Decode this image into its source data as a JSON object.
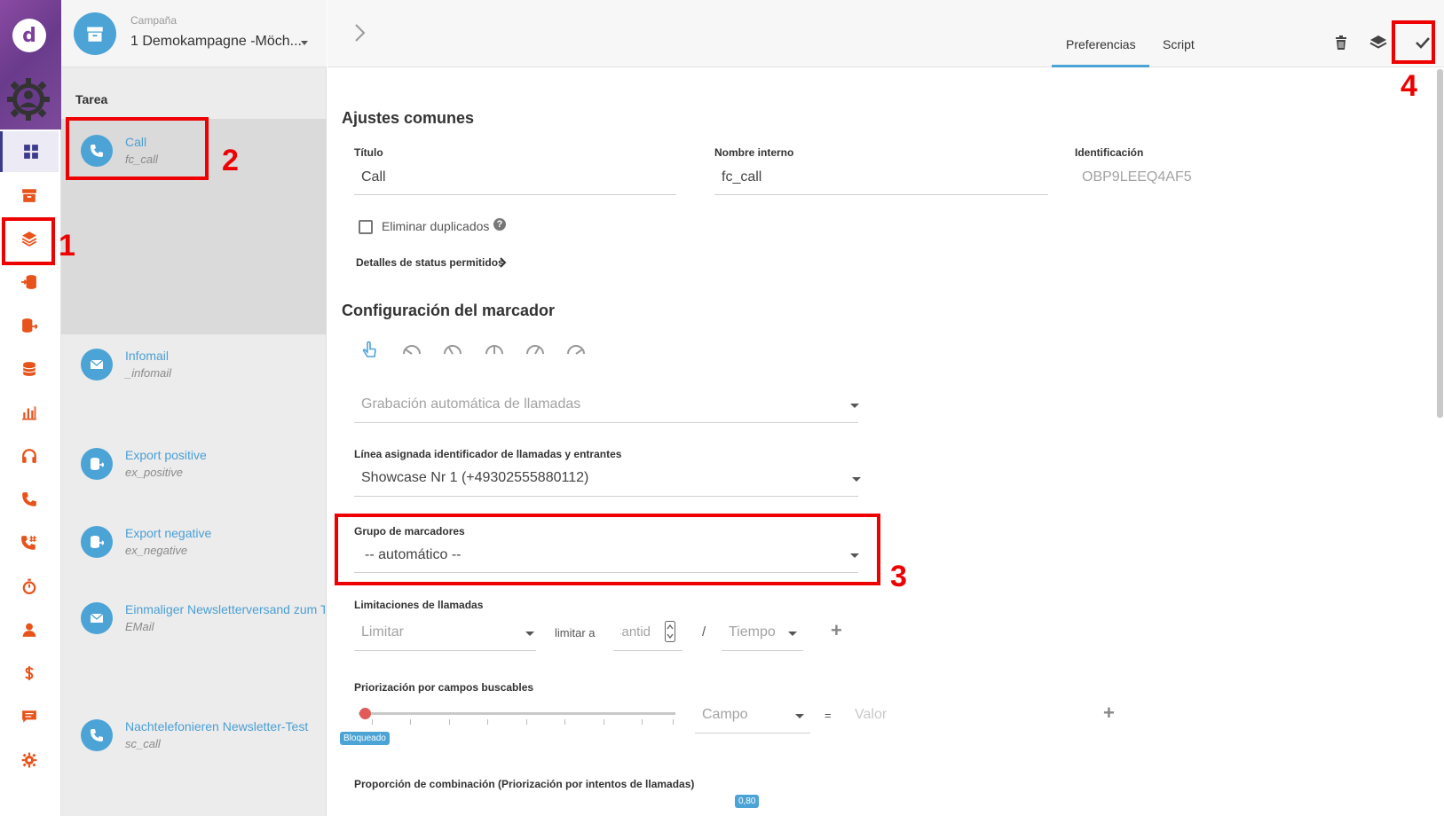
{
  "campaign": {
    "label": "Campaña",
    "value": "1 Demokampagne -Möch..."
  },
  "tasks_header": "Tarea",
  "tasks": [
    {
      "name": "Call",
      "sub": "fc_call",
      "icon": "phone-icon",
      "selected": true
    },
    {
      "name": "Infomail",
      "sub": "_infomail",
      "icon": "envelope-icon"
    },
    {
      "name": "Export positive",
      "sub": "ex_positive",
      "icon": "database-export-icon"
    },
    {
      "name": "Export negative",
      "sub": "ex_negative",
      "icon": "database-export-icon"
    },
    {
      "name": "Einmaliger Newsletterversand zum T",
      "sub": "EMail",
      "icon": "envelope-icon"
    },
    {
      "name": "Nachtelefonieren Newsletter-Test",
      "sub": "sc_call",
      "icon": "phone-icon"
    }
  ],
  "tabs": {
    "preferences": "Preferencias",
    "script": "Script"
  },
  "common": {
    "title": "Ajustes comunes",
    "titulo_label": "Título",
    "titulo_value": "Call",
    "internal_label": "Nombre interno",
    "internal_value": "fc_call",
    "id_label": "Identificación",
    "id_value": "OBP9LEEQ4AF5",
    "dup_label": "Eliminar duplicados",
    "status_details": "Detalles de status permitidos"
  },
  "dialer": {
    "title": "Configuración del marcador",
    "recording_placeholder": "Grabación automática de llamadas",
    "line_label": "Línea asignada identificador de llamadas y entrantes",
    "line_value": "Showcase Nr 1 (+49302555880112)",
    "group_label": "Grupo de marcadores",
    "group_value": "-- automático --",
    "limits_label": "Limitaciones de llamadas",
    "limit_placeholder": "Limitar",
    "limit_to": "limitar a",
    "amount_placeholder": "Cantid",
    "slash": "/",
    "time_placeholder": "Tiempo",
    "priority_label": "Priorización por campos buscables",
    "field_placeholder": "Campo",
    "equals": "=",
    "value_placeholder": "Valor",
    "blocked_badge": "Bloqueado",
    "mix_label": "Proporción de combinación (Priorización por intentos de llamadas)",
    "mix_value": "0,80"
  },
  "annotations": [
    "1",
    "2",
    "3",
    "4"
  ],
  "colors": {
    "accent": "#4ba3d6",
    "rail_icon": "#e8531c",
    "annotation": "#ee0000",
    "brand": "#7d3f9d"
  }
}
